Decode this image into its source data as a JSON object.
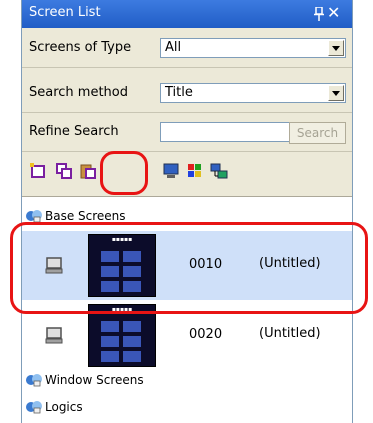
{
  "panel": {
    "title": "Screen List",
    "pin_icon": "pin-icon",
    "close_glyph": "✕"
  },
  "filters": {
    "screens_of_type": {
      "label": "Screens of Type",
      "value": "All"
    },
    "search_method": {
      "label": "Search method",
      "value": "Title"
    },
    "refine_search": {
      "label": "Refine Search",
      "value": "",
      "button_label": "Search"
    }
  },
  "toolbar": {
    "icons": [
      "new-screen-icon",
      "copy-screen-icon",
      "paste-screen-icon",
      "delete-icon",
      "display-icon",
      "color-palette-icon",
      "network-icon"
    ],
    "highlighted": "delete-icon"
  },
  "list": {
    "groups": [
      {
        "label": "Base Screens",
        "icon": "folder-screens-icon"
      },
      {
        "label": "Window Screens",
        "icon": "folder-screens-icon"
      },
      {
        "label": "Logics",
        "icon": "folder-screens-icon"
      }
    ],
    "items": [
      {
        "number": "0010",
        "title": "(Untitled)",
        "selected": true
      },
      {
        "number": "0020",
        "title": "(Untitled)",
        "selected": false
      }
    ]
  },
  "colors": {
    "title_bar": "#215dc6",
    "selection": "#cfe0f9",
    "highlight": "#e81414"
  }
}
